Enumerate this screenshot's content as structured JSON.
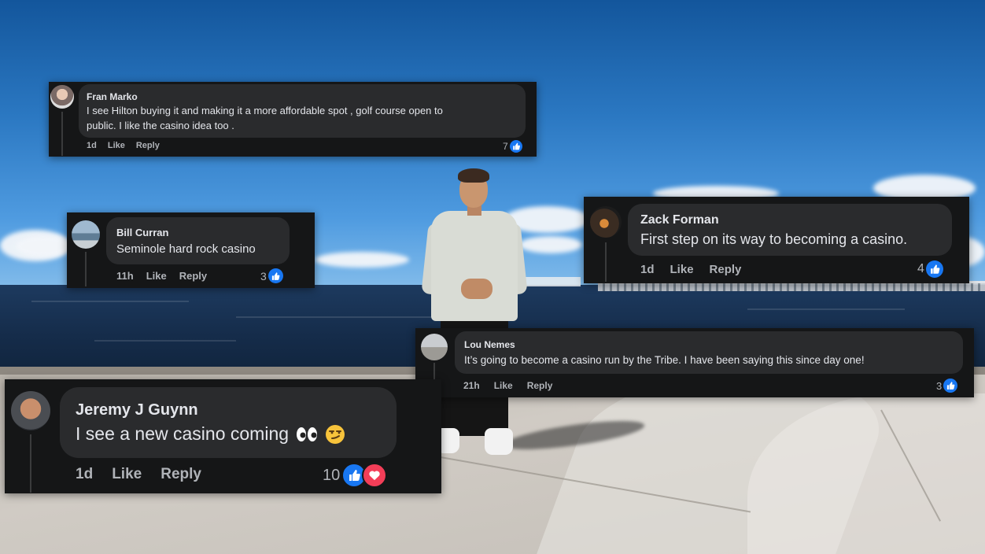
{
  "comments": [
    {
      "id": "fran",
      "name": "Fran Marko",
      "text_line1": "I see Hilton buying it and making it a more affordable spot , golf course open to",
      "text_line2": "public. I like the casino idea too .",
      "time": "1d",
      "like": "Like",
      "reply": "Reply",
      "count": "7"
    },
    {
      "id": "bill",
      "name": "Bill Curran",
      "text": "Seminole hard rock casino",
      "time": "11h",
      "like": "Like",
      "reply": "Reply",
      "count": "3"
    },
    {
      "id": "zack",
      "name": "Zack Forman",
      "text": "First step on its way to becoming a casino.",
      "time": "1d",
      "like": "Like",
      "reply": "Reply",
      "count": "4"
    },
    {
      "id": "lou",
      "name": "Lou Nemes",
      "text": "It’s going to become a casino run by the Tribe. I have been saying this since day one!",
      "time": "21h",
      "like": "Like",
      "reply": "Reply",
      "count": "3"
    },
    {
      "id": "jeremy",
      "name": "Jeremy J Guynn",
      "text": "I see a new casino coming",
      "time": "1d",
      "like": "Like",
      "reply": "Reply",
      "count": "10"
    }
  ],
  "icons": {
    "reaction_like": "thumbs-up-icon",
    "reaction_love": "heart-icon",
    "emoji_eyes": "eyes-emoji",
    "emoji_smirk": "smirk-emoji"
  },
  "colors": {
    "card_bg": "#151617",
    "bubble_bg": "#2a2b2d",
    "text": "#e4e6eb",
    "meta": "#b0b3b8",
    "like_blue": "#1877f2",
    "love_red": "#f33e58"
  }
}
